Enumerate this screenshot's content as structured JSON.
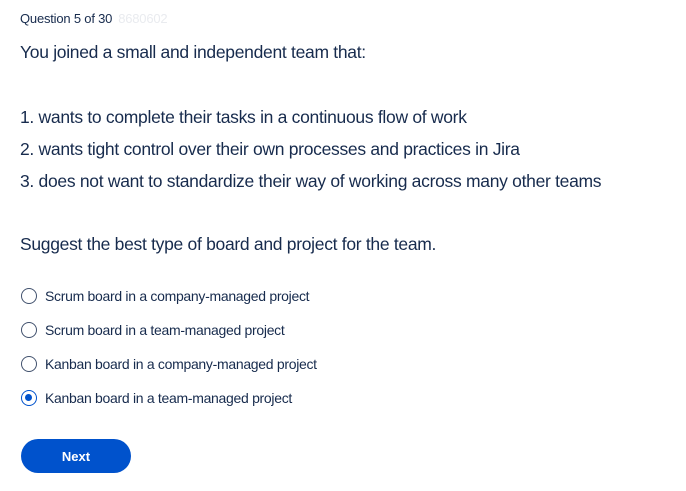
{
  "header": {
    "question_counter": "Question 5 of 30",
    "question_code": "8680602"
  },
  "question": {
    "intro": "You joined a small and independent team that:",
    "requirements": [
      "1. wants to complete their tasks in a continuous flow of work",
      "2. wants tight control over their own processes and practices in Jira",
      "3. does not want to standardize their way of working across many other teams"
    ],
    "prompt": "Suggest the best type of board and project for the team."
  },
  "options": [
    {
      "label": "Scrum board in a company-managed project",
      "selected": false
    },
    {
      "label": "Scrum board in a team-managed project",
      "selected": false
    },
    {
      "label": "Kanban board in a company-managed project",
      "selected": false
    },
    {
      "label": "Kanban board in a team-managed project",
      "selected": true
    }
  ],
  "actions": {
    "next_label": "Next"
  },
  "colors": {
    "accent": "#0052cc",
    "text": "#172b4d"
  }
}
